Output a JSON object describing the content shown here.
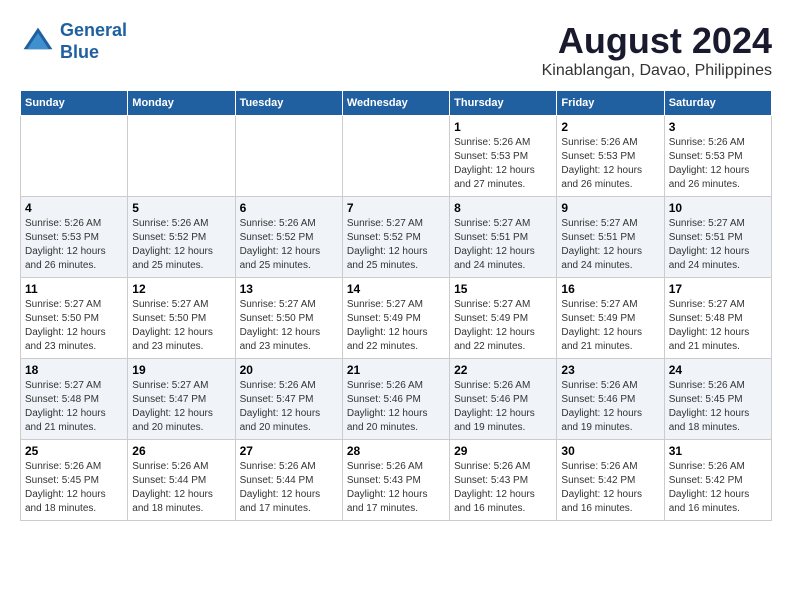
{
  "logo": {
    "line1": "General",
    "line2": "Blue"
  },
  "title": "August 2024",
  "subtitle": "Kinablangan, Davao, Philippines",
  "weekdays": [
    "Sunday",
    "Monday",
    "Tuesday",
    "Wednesday",
    "Thursday",
    "Friday",
    "Saturday"
  ],
  "weeks": [
    [
      {
        "day": "",
        "info": ""
      },
      {
        "day": "",
        "info": ""
      },
      {
        "day": "",
        "info": ""
      },
      {
        "day": "",
        "info": ""
      },
      {
        "day": "1",
        "info": "Sunrise: 5:26 AM\nSunset: 5:53 PM\nDaylight: 12 hours\nand 27 minutes."
      },
      {
        "day": "2",
        "info": "Sunrise: 5:26 AM\nSunset: 5:53 PM\nDaylight: 12 hours\nand 26 minutes."
      },
      {
        "day": "3",
        "info": "Sunrise: 5:26 AM\nSunset: 5:53 PM\nDaylight: 12 hours\nand 26 minutes."
      }
    ],
    [
      {
        "day": "4",
        "info": "Sunrise: 5:26 AM\nSunset: 5:53 PM\nDaylight: 12 hours\nand 26 minutes."
      },
      {
        "day": "5",
        "info": "Sunrise: 5:26 AM\nSunset: 5:52 PM\nDaylight: 12 hours\nand 25 minutes."
      },
      {
        "day": "6",
        "info": "Sunrise: 5:26 AM\nSunset: 5:52 PM\nDaylight: 12 hours\nand 25 minutes."
      },
      {
        "day": "7",
        "info": "Sunrise: 5:27 AM\nSunset: 5:52 PM\nDaylight: 12 hours\nand 25 minutes."
      },
      {
        "day": "8",
        "info": "Sunrise: 5:27 AM\nSunset: 5:51 PM\nDaylight: 12 hours\nand 24 minutes."
      },
      {
        "day": "9",
        "info": "Sunrise: 5:27 AM\nSunset: 5:51 PM\nDaylight: 12 hours\nand 24 minutes."
      },
      {
        "day": "10",
        "info": "Sunrise: 5:27 AM\nSunset: 5:51 PM\nDaylight: 12 hours\nand 24 minutes."
      }
    ],
    [
      {
        "day": "11",
        "info": "Sunrise: 5:27 AM\nSunset: 5:50 PM\nDaylight: 12 hours\nand 23 minutes."
      },
      {
        "day": "12",
        "info": "Sunrise: 5:27 AM\nSunset: 5:50 PM\nDaylight: 12 hours\nand 23 minutes."
      },
      {
        "day": "13",
        "info": "Sunrise: 5:27 AM\nSunset: 5:50 PM\nDaylight: 12 hours\nand 23 minutes."
      },
      {
        "day": "14",
        "info": "Sunrise: 5:27 AM\nSunset: 5:49 PM\nDaylight: 12 hours\nand 22 minutes."
      },
      {
        "day": "15",
        "info": "Sunrise: 5:27 AM\nSunset: 5:49 PM\nDaylight: 12 hours\nand 22 minutes."
      },
      {
        "day": "16",
        "info": "Sunrise: 5:27 AM\nSunset: 5:49 PM\nDaylight: 12 hours\nand 21 minutes."
      },
      {
        "day": "17",
        "info": "Sunrise: 5:27 AM\nSunset: 5:48 PM\nDaylight: 12 hours\nand 21 minutes."
      }
    ],
    [
      {
        "day": "18",
        "info": "Sunrise: 5:27 AM\nSunset: 5:48 PM\nDaylight: 12 hours\nand 21 minutes."
      },
      {
        "day": "19",
        "info": "Sunrise: 5:27 AM\nSunset: 5:47 PM\nDaylight: 12 hours\nand 20 minutes."
      },
      {
        "day": "20",
        "info": "Sunrise: 5:26 AM\nSunset: 5:47 PM\nDaylight: 12 hours\nand 20 minutes."
      },
      {
        "day": "21",
        "info": "Sunrise: 5:26 AM\nSunset: 5:46 PM\nDaylight: 12 hours\nand 20 minutes."
      },
      {
        "day": "22",
        "info": "Sunrise: 5:26 AM\nSunset: 5:46 PM\nDaylight: 12 hours\nand 19 minutes."
      },
      {
        "day": "23",
        "info": "Sunrise: 5:26 AM\nSunset: 5:46 PM\nDaylight: 12 hours\nand 19 minutes."
      },
      {
        "day": "24",
        "info": "Sunrise: 5:26 AM\nSunset: 5:45 PM\nDaylight: 12 hours\nand 18 minutes."
      }
    ],
    [
      {
        "day": "25",
        "info": "Sunrise: 5:26 AM\nSunset: 5:45 PM\nDaylight: 12 hours\nand 18 minutes."
      },
      {
        "day": "26",
        "info": "Sunrise: 5:26 AM\nSunset: 5:44 PM\nDaylight: 12 hours\nand 18 minutes."
      },
      {
        "day": "27",
        "info": "Sunrise: 5:26 AM\nSunset: 5:44 PM\nDaylight: 12 hours\nand 17 minutes."
      },
      {
        "day": "28",
        "info": "Sunrise: 5:26 AM\nSunset: 5:43 PM\nDaylight: 12 hours\nand 17 minutes."
      },
      {
        "day": "29",
        "info": "Sunrise: 5:26 AM\nSunset: 5:43 PM\nDaylight: 12 hours\nand 16 minutes."
      },
      {
        "day": "30",
        "info": "Sunrise: 5:26 AM\nSunset: 5:42 PM\nDaylight: 12 hours\nand 16 minutes."
      },
      {
        "day": "31",
        "info": "Sunrise: 5:26 AM\nSunset: 5:42 PM\nDaylight: 12 hours\nand 16 minutes."
      }
    ]
  ]
}
